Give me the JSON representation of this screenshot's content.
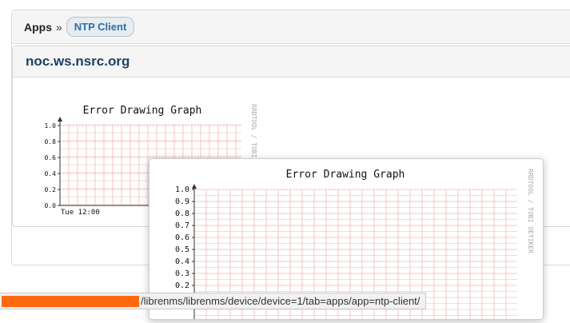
{
  "breadcrumb": {
    "apps_label": "Apps",
    "separator": "»",
    "current_label": "NTP Client"
  },
  "device": {
    "hostname": "noc.ws.nsrc.org"
  },
  "graph_small": {
    "title": "Error Drawing Graph",
    "y_ticks": [
      "1.0",
      "0.8",
      "0.6",
      "0.4",
      "0.2",
      "0.0"
    ],
    "x_label": "Tue 12:00",
    "side_text": "RRDTOOL / TOBI"
  },
  "graph_large": {
    "title": "Error Drawing Graph",
    "y_ticks": [
      "1.0",
      "0.9",
      "0.8",
      "0.7",
      "0.6",
      "0.5",
      "0.4",
      "0.3",
      "0.2"
    ],
    "side_text": "RRDTOOL / TOBI OETIKER"
  },
  "status_bar": {
    "url_text": "/librenms/librenms/device/device=1/tab=apps/app=ntp-client/"
  },
  "colors": {
    "grid": "#f4b6b6",
    "redaction": "#ff6a10"
  }
}
